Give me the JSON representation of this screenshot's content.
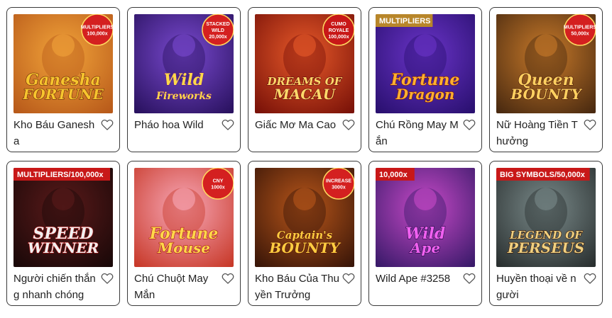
{
  "games": [
    {
      "title": "Kho Báu Ganesha",
      "art": {
        "bg1": "#f2a43a",
        "bg2": "#b85a1a",
        "logo_lines": [
          "Ganesha",
          "FORTUNE"
        ],
        "logo_color": "#f7c52e",
        "logo_stroke": "#6b2a0a",
        "badge_lines": [
          "MULTIPLIERS",
          "100,000x"
        ],
        "badge_color": "#d42020",
        "banner": ""
      }
    },
    {
      "title": "Pháo hoa Wild",
      "art": {
        "bg1": "#7a4ad0",
        "bg2": "#2a1260",
        "logo_lines": [
          "Wild",
          "Fireworks"
        ],
        "logo_color": "#ffd84a",
        "logo_stroke": "#5a1a8a",
        "badge_lines": [
          "STACKED",
          "WILD",
          "20,000x"
        ],
        "badge_color": "#d42020",
        "banner": ""
      }
    },
    {
      "title": "Giấc Mơ Ma Cao",
      "art": {
        "bg1": "#e85a2a",
        "bg2": "#7a1208",
        "logo_lines": [
          "DREAMS OF",
          "MACAU"
        ],
        "logo_color": "#ffd86a",
        "logo_stroke": "#6a0c0c",
        "badge_lines": [
          "CUMO",
          "ROYALE",
          "100,000x"
        ],
        "badge_color": "#c81818",
        "banner": ""
      }
    },
    {
      "title": "Chú Rồng May Mắn",
      "art": {
        "bg1": "#6a34c8",
        "bg2": "#2a1070",
        "logo_lines": [
          "Fortune",
          "Dragon"
        ],
        "logo_color": "#ffb030",
        "logo_stroke": "#7a1a0a",
        "badge_lines": [],
        "badge_color": "#d42020",
        "banner": "MULTIPLIERS"
      }
    },
    {
      "title": "Nữ Hoàng Tiền Thưởng",
      "art": {
        "bg1": "#c87a2a",
        "bg2": "#4a2a10",
        "logo_lines": [
          "Queen",
          "BOUNTY"
        ],
        "logo_color": "#ffd060",
        "logo_stroke": "#4a1a08",
        "badge_lines": [
          "MULTIPLIERS",
          "50,000x"
        ],
        "badge_color": "#d42020",
        "banner": ""
      }
    },
    {
      "title": "Người chiến thắng nhanh chóng",
      "art": {
        "bg1": "#5a1a1a",
        "bg2": "#1a0808",
        "logo_lines": [
          "SPEED",
          "WINNER"
        ],
        "logo_color": "#f0f0f0",
        "logo_stroke": "#b81a1a",
        "badge_lines": [],
        "badge_color": "#d42020",
        "banner": "MULTIPLIERS/100,000x"
      }
    },
    {
      "title": "Chú Chuột May Mắn",
      "art": {
        "bg1": "#f8a8b8",
        "bg2": "#c83a2a",
        "logo_lines": [
          "Fortune",
          "Mouse"
        ],
        "logo_color": "#ffd84a",
        "logo_stroke": "#a81818",
        "badge_lines": [
          "CNY",
          "1000x"
        ],
        "badge_color": "#d42020",
        "banner": ""
      }
    },
    {
      "title": "Kho Báu Của Thuyền Trưởng",
      "art": {
        "bg1": "#b8561a",
        "bg2": "#3a1608",
        "logo_lines": [
          "Captain's",
          "BOUNTY"
        ],
        "logo_color": "#ffcc40",
        "logo_stroke": "#5a1a08",
        "badge_lines": [
          "INCREASE",
          "3000x"
        ],
        "badge_color": "#d42020",
        "banner": ""
      }
    },
    {
      "title": "Wild Ape #3258",
      "art": {
        "bg1": "#c84ac8",
        "bg2": "#3a1a6a",
        "logo_lines": [
          "Wild",
          "Ape"
        ],
        "logo_color": "#f060f0",
        "logo_stroke": "#2a0a4a",
        "badge_lines": [],
        "badge_color": "#d42020",
        "banner": "10,000x"
      }
    },
    {
      "title": "Huyền thoại về người",
      "art": {
        "bg1": "#7a8a8a",
        "bg2": "#2a3030",
        "logo_lines": [
          "LEGEND OF",
          "PERSEUS"
        ],
        "logo_color": "#f0d080",
        "logo_stroke": "#3a1a08",
        "badge_lines": [],
        "badge_color": "#d42020",
        "banner": "BIG SYMBOLS/50,000x"
      }
    }
  ]
}
